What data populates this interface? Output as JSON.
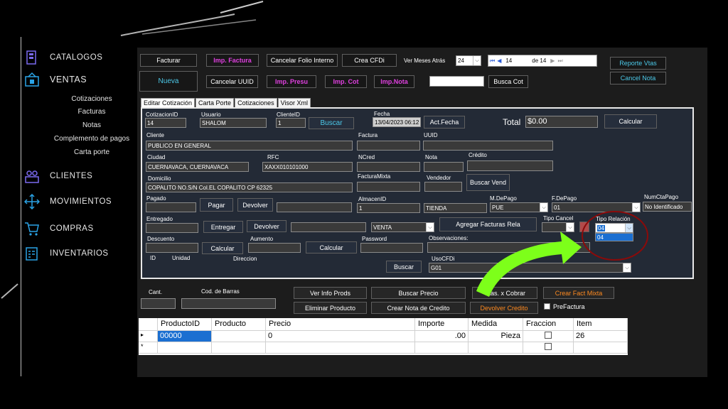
{
  "sidebar": {
    "items": [
      {
        "label": "CATALOGOS",
        "icon": "catalog-icon"
      },
      {
        "label": "VENTAS",
        "icon": "sales-icon"
      },
      {
        "label": "CLIENTES",
        "icon": "clients-icon"
      },
      {
        "label": "MOVIMIENTOS",
        "icon": "move-icon"
      },
      {
        "label": "COMPRAS",
        "icon": "cart-icon"
      },
      {
        "label": "INVENTARIOS",
        "icon": "inventory-icon"
      }
    ],
    "ventas_sub": [
      "Cotizaciones",
      "Facturas",
      "Notas",
      "Complemento de pagos",
      "Carta porte"
    ]
  },
  "toolbar": {
    "facturar": "Facturar",
    "imp_factura": "Imp. Factura",
    "cancelar_folio": "Cancelar Folio Interno",
    "crea_cfdi": "Crea CFDi",
    "ver_meses_label": "Ver Meses Atrás",
    "ver_meses_value": "24",
    "nav_current": "14",
    "nav_total": "de 14",
    "reporte_vtas": "Reporte Vtas",
    "nueva": "Nueva",
    "cancelar_uuid": "Cancelar UUID",
    "imp_presu": "Imp. Presu",
    "imp_cot": "Imp. Cot",
    "imp_nota": "Imp.Nota",
    "busca_cot": "Busca Cot",
    "cancel_nota": "Cancel Nota"
  },
  "tabs": [
    "Editar Cotización",
    "Carta Porte",
    "Cotizaciones",
    "Visor Xml"
  ],
  "form": {
    "cotizacion_id_label": "CotizacionID",
    "cotizacion_id": "14",
    "usuario_label": "Usuario",
    "usuario": "SHALOM",
    "cliente_id_label": "ClienteID",
    "cliente_id": "1",
    "buscar": "Buscar",
    "fecha_label": "Fecha",
    "fecha": "13/04/2023 06:12",
    "act_fecha": "Act.Fecha",
    "total_label": "Total",
    "total": "$0.00",
    "calcular": "Calcular",
    "cliente_label": "Cliente",
    "cliente": "PUBLICO EN GENERAL",
    "factura_label": "Factura",
    "uuid_label": "UUID",
    "ciudad_label": "Ciudad",
    "ciudad": "CUERNAVACA, CUERNAVACA",
    "rfc_label": "RFC",
    "rfc": "XAXX010101000",
    "ncred_label": "NCred",
    "nota_label": "Nota",
    "credito_label": "Crédito",
    "domicilio_label": "Domicilio",
    "domicilio": "COPALITO NO.S/N Col.EL COPALITO CP 62325",
    "factura_mixta_label": "FacturaMixta",
    "vendedor_label": "Vendedor",
    "buscar_vend": "Buscar Vend",
    "pagado_label": "Pagado",
    "pagar": "Pagar",
    "devolver": "Devolver",
    "almacen_label": "AlmacenID",
    "almacen": "1",
    "tienda": "TIENDA",
    "mdepago_label": "M.DePago",
    "mdepago": "PUE",
    "fdepago_label": "F.DePago",
    "fdepago": "01",
    "numcta_label": "NumCtaPago",
    "numcta": "No Identificado",
    "entregado_label": "Entregado",
    "entregar": "Entregar",
    "venta": "VENTA",
    "agregar_facturas": "Agregar Facturas Rela",
    "tipo_cancel_label": "Tipo Cancel",
    "tipo_relacion_label": "Tipo Relación",
    "tipo_relacion": "04",
    "tipo_relacion_option": "04",
    "descuento_label": "Descuento",
    "aumento_label": "Aumento",
    "password_label": "Password",
    "observaciones_label": "Observaciones:",
    "id_label": "ID",
    "unidad_label": "Unidad",
    "direccion_label": "Direccion",
    "uso_cfdi_label": "UsoCFDi",
    "uso_cfdi": "G01",
    "buscar2": "Buscar"
  },
  "bottom": {
    "cant_label": "Cant.",
    "cod_barras_label": "Cod. de Barras",
    "ver_info_prods": "Ver Info Prods",
    "eliminar_producto": "Eliminar Producto",
    "buscar_precio": "Buscar Precio",
    "crear_nota_credito": "Crear Nota de Credito",
    "ctas_cobrar": "Ctas. x Cobrar",
    "devolver_credito": "Devolver Credito",
    "crear_fact_mixta": "Crear Fact Mixta",
    "prefactura": "PreFactura"
  },
  "grid": {
    "headers": [
      "ProductoID",
      "Producto",
      "Precio",
      "Importe",
      "Medida",
      "Fraccion",
      "Item"
    ],
    "row": {
      "productoid": "00000",
      "producto": "",
      "precio": "0",
      "importe": ".00",
      "medida": "Pieza",
      "item": "26"
    }
  },
  "colors": {
    "accent_pink": "#e040e0",
    "accent_cyan": "#4cc8e8",
    "accent_orange": "#ff8a1f",
    "arrow_green": "#7dff1a",
    "circle_red": "#8b0a0a"
  }
}
